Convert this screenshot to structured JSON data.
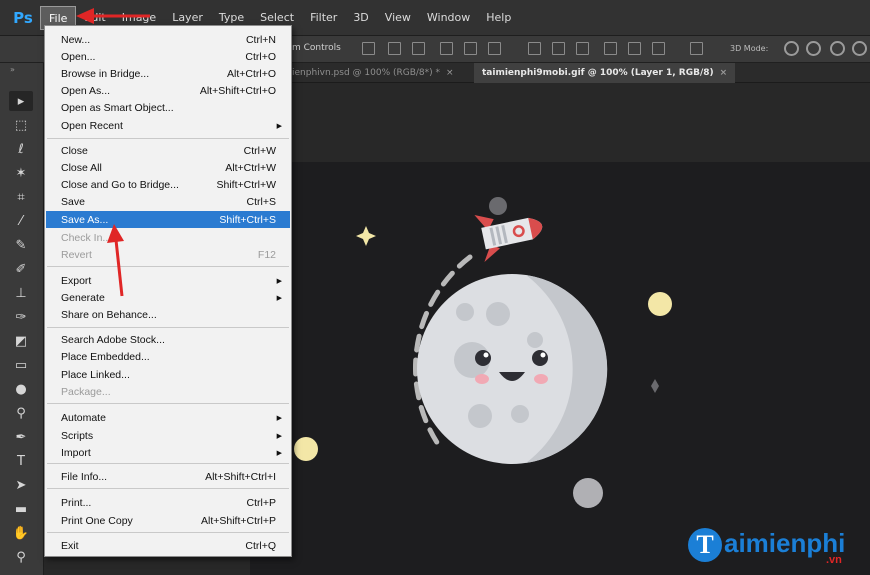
{
  "app": {
    "logo": "Ps"
  },
  "menubar": {
    "items": [
      "File",
      "Edit",
      "Image",
      "Layer",
      "Type",
      "Select",
      "Filter",
      "3D",
      "View",
      "Window",
      "Help"
    ]
  },
  "options": {
    "align_text": "m Controls",
    "mode_3d": "3D Mode:"
  },
  "tabs": [
    {
      "label": "ienphivn.psd @ 100% (RGB/8*) *",
      "close": "×"
    },
    {
      "label": "taimienphi9mobi.gif @ 100% (Layer 1, RGB/8)",
      "close": "×"
    }
  ],
  "file_menu": {
    "items": [
      {
        "label": "New...",
        "shortcut": "Ctrl+N"
      },
      {
        "label": "Open...",
        "shortcut": "Ctrl+O"
      },
      {
        "label": "Browse in Bridge...",
        "shortcut": "Alt+Ctrl+O"
      },
      {
        "label": "Open As...",
        "shortcut": "Alt+Shift+Ctrl+O"
      },
      {
        "label": "Open as Smart Object...",
        "shortcut": ""
      },
      {
        "label": "Open Recent",
        "shortcut": "",
        "arrow": "▶"
      },
      {
        "label": "Close",
        "shortcut": "Ctrl+W"
      },
      {
        "label": "Close All",
        "shortcut": "Alt+Ctrl+W"
      },
      {
        "label": "Close and Go to Bridge...",
        "shortcut": "Shift+Ctrl+W"
      },
      {
        "label": "Save",
        "shortcut": "Ctrl+S"
      },
      {
        "label": "Save As...",
        "shortcut": "Shift+Ctrl+S"
      },
      {
        "label": "Check In...",
        "shortcut": ""
      },
      {
        "label": "Revert",
        "shortcut": "F12"
      },
      {
        "label": "Export",
        "shortcut": "",
        "arrow": "▶"
      },
      {
        "label": "Generate",
        "shortcut": "",
        "arrow": "▶"
      },
      {
        "label": "Share on Behance...",
        "shortcut": ""
      },
      {
        "label": "Search Adobe Stock...",
        "shortcut": ""
      },
      {
        "label": "Place Embedded...",
        "shortcut": ""
      },
      {
        "label": "Place Linked...",
        "shortcut": ""
      },
      {
        "label": "Package...",
        "shortcut": ""
      },
      {
        "label": "Automate",
        "shortcut": "",
        "arrow": "▶"
      },
      {
        "label": "Scripts",
        "shortcut": "",
        "arrow": "▶"
      },
      {
        "label": "Import",
        "shortcut": "",
        "arrow": "▶"
      },
      {
        "label": "File Info...",
        "shortcut": "Alt+Shift+Ctrl+I"
      },
      {
        "label": "Print...",
        "shortcut": "Ctrl+P"
      },
      {
        "label": "Print One Copy",
        "shortcut": "Alt+Shift+Ctrl+P"
      },
      {
        "label": "Exit",
        "shortcut": "Ctrl+Q"
      }
    ]
  },
  "watermark": {
    "letter": "T",
    "text": "aimienphi",
    "tld": ".vn"
  },
  "colors": {
    "accent": "#2b7bd1",
    "annotation": "#e02626",
    "moon": "#dcdee2",
    "star_yellow": "#f3e7a7"
  }
}
